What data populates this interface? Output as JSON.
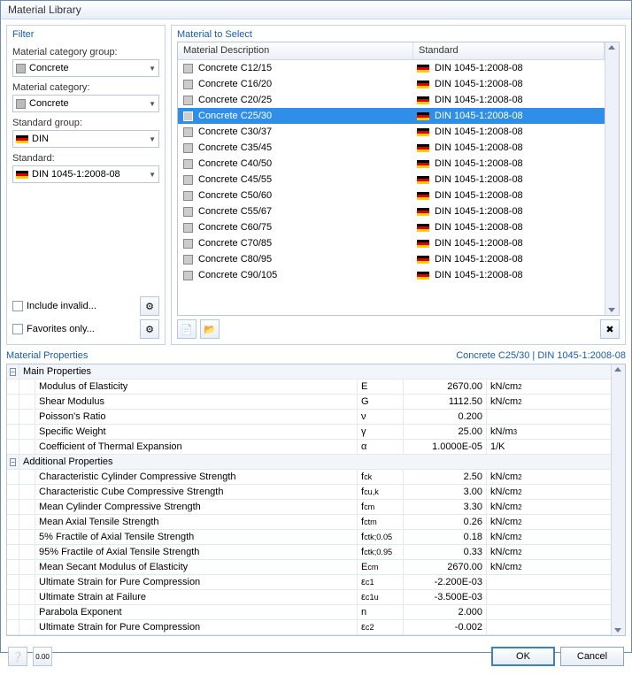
{
  "window_title": "Material Library",
  "filter": {
    "title": "Filter",
    "labels": {
      "category_group": "Material category group:",
      "category": "Material category:",
      "standard_group": "Standard group:",
      "standard": "Standard:"
    },
    "values": {
      "category_group": "Concrete",
      "category": "Concrete",
      "standard_group": "DIN",
      "standard": "DIN 1045-1:2008-08"
    },
    "include_invalid": "Include invalid...",
    "favorites_only": "Favorites only..."
  },
  "material_select": {
    "title": "Material to Select",
    "headers": {
      "desc": "Material Description",
      "std": "Standard"
    },
    "selected_index": 3,
    "rows": [
      {
        "desc": "Concrete C12/15",
        "std": "DIN 1045-1:2008-08"
      },
      {
        "desc": "Concrete C16/20",
        "std": "DIN 1045-1:2008-08"
      },
      {
        "desc": "Concrete C20/25",
        "std": "DIN 1045-1:2008-08"
      },
      {
        "desc": "Concrete C25/30",
        "std": "DIN 1045-1:2008-08"
      },
      {
        "desc": "Concrete C30/37",
        "std": "DIN 1045-1:2008-08"
      },
      {
        "desc": "Concrete C35/45",
        "std": "DIN 1045-1:2008-08"
      },
      {
        "desc": "Concrete C40/50",
        "std": "DIN 1045-1:2008-08"
      },
      {
        "desc": "Concrete C45/55",
        "std": "DIN 1045-1:2008-08"
      },
      {
        "desc": "Concrete C50/60",
        "std": "DIN 1045-1:2008-08"
      },
      {
        "desc": "Concrete C55/67",
        "std": "DIN 1045-1:2008-08"
      },
      {
        "desc": "Concrete C60/75",
        "std": "DIN 1045-1:2008-08"
      },
      {
        "desc": "Concrete C70/85",
        "std": "DIN 1045-1:2008-08"
      },
      {
        "desc": "Concrete C80/95",
        "std": "DIN 1045-1:2008-08"
      },
      {
        "desc": "Concrete C90/105",
        "std": "DIN 1045-1:2008-08"
      }
    ]
  },
  "properties": {
    "title": "Material Properties",
    "context": "Concrete C25/30  |  DIN 1045-1:2008-08",
    "groups": [
      {
        "name": "Main Properties",
        "rows": [
          {
            "name": "Modulus of Elasticity",
            "sym": "E",
            "val": "2670.00",
            "unit": "kN/cm²"
          },
          {
            "name": "Shear Modulus",
            "sym": "G",
            "val": "1112.50",
            "unit": "kN/cm²"
          },
          {
            "name": "Poisson's Ratio",
            "sym": "ν",
            "val": "0.200",
            "unit": ""
          },
          {
            "name": "Specific Weight",
            "sym": "γ",
            "val": "25.00",
            "unit": "kN/m³"
          },
          {
            "name": "Coefficient of Thermal Expansion",
            "sym": "α",
            "val": "1.0000E-05",
            "unit": "1/K"
          }
        ]
      },
      {
        "name": "Additional Properties",
        "rows": [
          {
            "name": "Characteristic Cylinder Compressive Strength",
            "sym": "f_ck",
            "val": "2.50",
            "unit": "kN/cm²"
          },
          {
            "name": "Characteristic Cube Compressive Strength",
            "sym": "f_cu,k",
            "val": "3.00",
            "unit": "kN/cm²"
          },
          {
            "name": "Mean Cylinder Compressive Strength",
            "sym": "f_cm",
            "val": "3.30",
            "unit": "kN/cm²"
          },
          {
            "name": "Mean Axial Tensile Strength",
            "sym": "f_ctm",
            "val": "0.26",
            "unit": "kN/cm²"
          },
          {
            "name": "5% Fractile of Axial Tensile Strength",
            "sym": "f_ctk;0.05",
            "val": "0.18",
            "unit": "kN/cm²"
          },
          {
            "name": "95% Fractile of Axial Tensile Strength",
            "sym": "f_ctk;0.95",
            "val": "0.33",
            "unit": "kN/cm²"
          },
          {
            "name": "Mean Secant Modulus of Elasticity",
            "sym": "E_cm",
            "val": "2670.00",
            "unit": "kN/cm²"
          },
          {
            "name": "Ultimate Strain for Pure Compression",
            "sym": "ε_c1",
            "val": "-2.200E-03",
            "unit": ""
          },
          {
            "name": "Ultimate Strain at Failure",
            "sym": "ε_c1u",
            "val": "-3.500E-03",
            "unit": ""
          },
          {
            "name": "Parabola Exponent",
            "sym": "n",
            "val": "2.000",
            "unit": ""
          },
          {
            "name": "Ultimate Strain for Pure Compression",
            "sym": "ε_c2",
            "val": "-0.002",
            "unit": ""
          }
        ]
      }
    ]
  },
  "footer": {
    "ok": "OK",
    "cancel": "Cancel"
  }
}
